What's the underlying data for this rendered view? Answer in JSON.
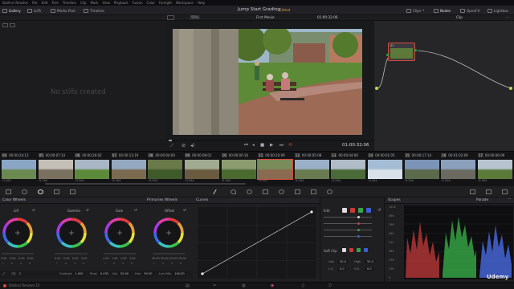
{
  "menu": [
    "DaVinci Resolve",
    "File",
    "Edit",
    "Trim",
    "Timeline",
    "Clip",
    "Mark",
    "View",
    "Playback",
    "Fusion",
    "Color",
    "Fairlight",
    "Workspace",
    "Help"
  ],
  "toolbar": {
    "gallery": "Gallery",
    "luts": "LUTs",
    "media_pool": "Media Pool",
    "timeline": "Timeline",
    "project_title": "Jump Start Grading",
    "edited": "Edited",
    "clips": "Clips",
    "nodes": "Nodes",
    "openfx": "OpenFX",
    "lightbox": "Lightbox"
  },
  "viewer_header": {
    "zoom": "55%",
    "clip_name": "First Movie",
    "timecode": "01:00:32:06",
    "clip_mode": "Clip"
  },
  "gallery": {
    "empty_text": "No stills created"
  },
  "viewer": {
    "timecode": "01:00:32:06"
  },
  "nodes": {
    "node_label": "01"
  },
  "clips": [
    {
      "num": "04",
      "tc": "00:00:24:13",
      "codec": "H.264"
    },
    {
      "num": "05",
      "tc": "00:00:07:14",
      "codec": "H.264"
    },
    {
      "num": "06",
      "tc": "00:00:26:02",
      "codec": "H.264"
    },
    {
      "num": "07",
      "tc": "00:00:13:19",
      "codec": "H.264"
    },
    {
      "num": "08",
      "tc": "00:00:04:00",
      "codec": "H.264"
    },
    {
      "num": "09",
      "tc": "00:00:08:01",
      "codec": "H.264"
    },
    {
      "num": "10",
      "tc": "00:00:00:16",
      "codec": "H.264"
    },
    {
      "num": "11",
      "tc": "00:00:20:09",
      "codec": "H.264"
    },
    {
      "num": "12",
      "tc": "00:00:05:08",
      "codec": "H.264"
    },
    {
      "num": "13",
      "tc": "00:00:04:06",
      "codec": "H.264"
    },
    {
      "num": "14",
      "tc": "00:00:01:05",
      "codec": "H.264"
    },
    {
      "num": "15",
      "tc": "00:00:17:14",
      "codec": "H.264"
    },
    {
      "num": "16",
      "tc": "00:01:02:09",
      "codec": "H.264"
    },
    {
      "num": "17",
      "tc": "00:00:06:09",
      "codec": "H.264"
    }
  ],
  "color_wheels": {
    "title": "Color Wheels",
    "mode": "Primaries Wheels",
    "wheels": [
      {
        "name": "Lift",
        "values": [
          "0.00",
          "0.00",
          "0.00",
          "0.00"
        ]
      },
      {
        "name": "Gamma",
        "values": [
          "0.00",
          "0.00",
          "0.00",
          "0.00"
        ]
      },
      {
        "name": "Gain",
        "values": [
          "1.00",
          "1.00",
          "1.00",
          "1.00"
        ]
      },
      {
        "name": "Offset",
        "values": [
          "25.00",
          "25.00",
          "25.00",
          "25.00"
        ]
      }
    ],
    "channel_labels": [
      "Y",
      "R",
      "G",
      "B"
    ],
    "params": [
      {
        "name": "Contrast",
        "value": "1.000"
      },
      {
        "name": "Pivot",
        "value": "0.435"
      },
      {
        "name": "Sat",
        "value": "50.00"
      },
      {
        "name": "Hue",
        "value": "50.00"
      },
      {
        "name": "Lum Mix",
        "value": "100.00"
      }
    ]
  },
  "curves": {
    "title": "Curves",
    "mode": "Custom"
  },
  "custom": {
    "edit_label": "Edit",
    "soft_clip": "Soft Clip",
    "low": "Low",
    "high": "High",
    "low_val": "50.0",
    "high_val": "50.0",
    "ls": "L.S.",
    "hs": "H.S.",
    "ls_val": "0.0",
    "hs_val": "0.0"
  },
  "scopes": {
    "title": "Scopes",
    "mode": "Parade",
    "ticks": [
      "1023",
      "896",
      "768",
      "640",
      "512",
      "384",
      "256",
      "128",
      "0"
    ]
  },
  "status": {
    "app_name": "DaVinci Resolve 15"
  },
  "watermark": "Udemy",
  "chart_data": {
    "type": "line",
    "title": "Curves",
    "series": [
      {
        "values": [
          [
            0,
            0
          ],
          [
            1,
            1
          ]
        ]
      }
    ],
    "xlim": [
      0,
      1
    ],
    "ylim": [
      0,
      1
    ]
  }
}
